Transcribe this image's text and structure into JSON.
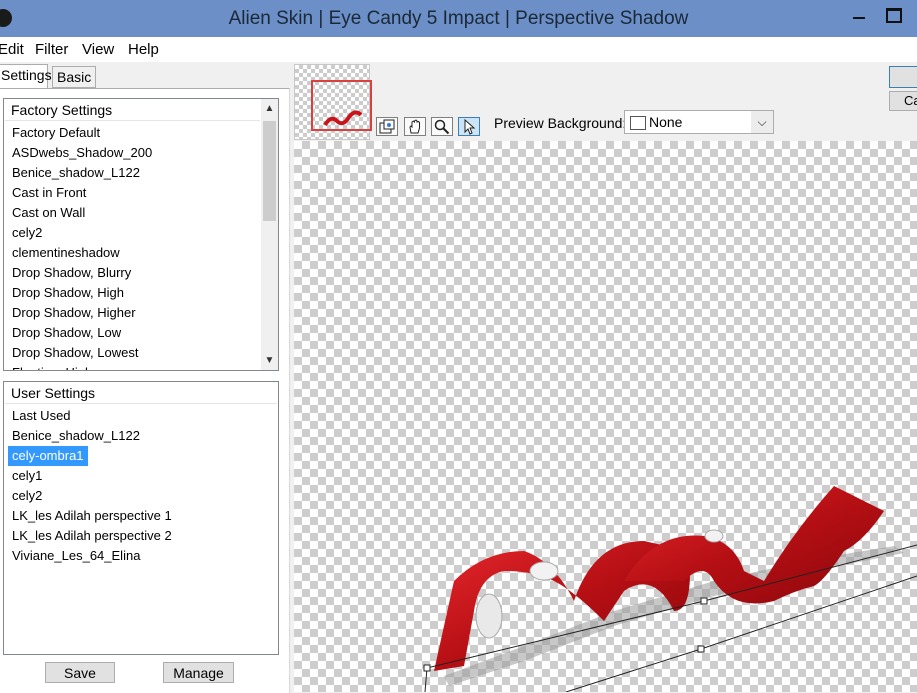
{
  "window": {
    "title": "Alien Skin | Eye Candy 5 Impact | Perspective Shadow"
  },
  "menu": [
    "Edit",
    "Filter",
    "View",
    "Help"
  ],
  "tabs": [
    {
      "label": "Settings",
      "active": true
    },
    {
      "label": "Basic",
      "active": false
    }
  ],
  "factory": {
    "header": "Factory Settings",
    "items": [
      "Factory Default",
      "ASDwebs_Shadow_200",
      "Benice_shadow_L122",
      "Cast in Front",
      "Cast on Wall",
      "cely2",
      "clementineshadow",
      "Drop Shadow, Blurry",
      "Drop Shadow, High",
      "Drop Shadow, Higher",
      "Drop Shadow, Low",
      "Drop Shadow, Lowest",
      "Floating, High"
    ]
  },
  "user": {
    "header": "User Settings",
    "items": [
      "Last Used",
      "Benice_shadow_L122",
      "cely-ombra1",
      "cely1",
      "cely2",
      "LK_les Adilah perspective 1",
      "LK_les Adilah perspective 2",
      "Viviane_Les_64_Elina"
    ],
    "selected": "cely-ombra1"
  },
  "buttons": {
    "save": "Save",
    "manage": "Manage",
    "cancel_partial": "Ca"
  },
  "toolbar": {
    "tools": [
      "navigator-icon",
      "hand-icon",
      "zoom-icon",
      "arrow-icon"
    ],
    "active_tool": "arrow-icon"
  },
  "preview_background": {
    "label": "Preview Background:",
    "value": "None"
  },
  "colors": {
    "titlebar": "#6b8fc6",
    "selection": "#3399ff",
    "ribbon": "#c8141a"
  }
}
